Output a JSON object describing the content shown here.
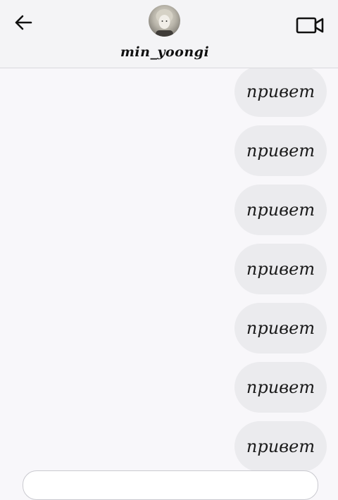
{
  "header": {
    "username": "min_yoongi",
    "back_icon": "arrow-left-icon",
    "video_icon": "video-camera-icon",
    "avatar": "profile-photo"
  },
  "messages": [
    {
      "text": "привет",
      "sender": "self"
    },
    {
      "text": "привет",
      "sender": "self"
    },
    {
      "text": "привет",
      "sender": "self"
    },
    {
      "text": "привет",
      "sender": "self"
    },
    {
      "text": "привет",
      "sender": "self"
    },
    {
      "text": "привет",
      "sender": "self"
    },
    {
      "text": "привет",
      "sender": "self"
    }
  ],
  "colors": {
    "background": "#f8f7fa",
    "header": "#f4f4f6",
    "bubble": "#ebebee",
    "text": "#111111"
  }
}
